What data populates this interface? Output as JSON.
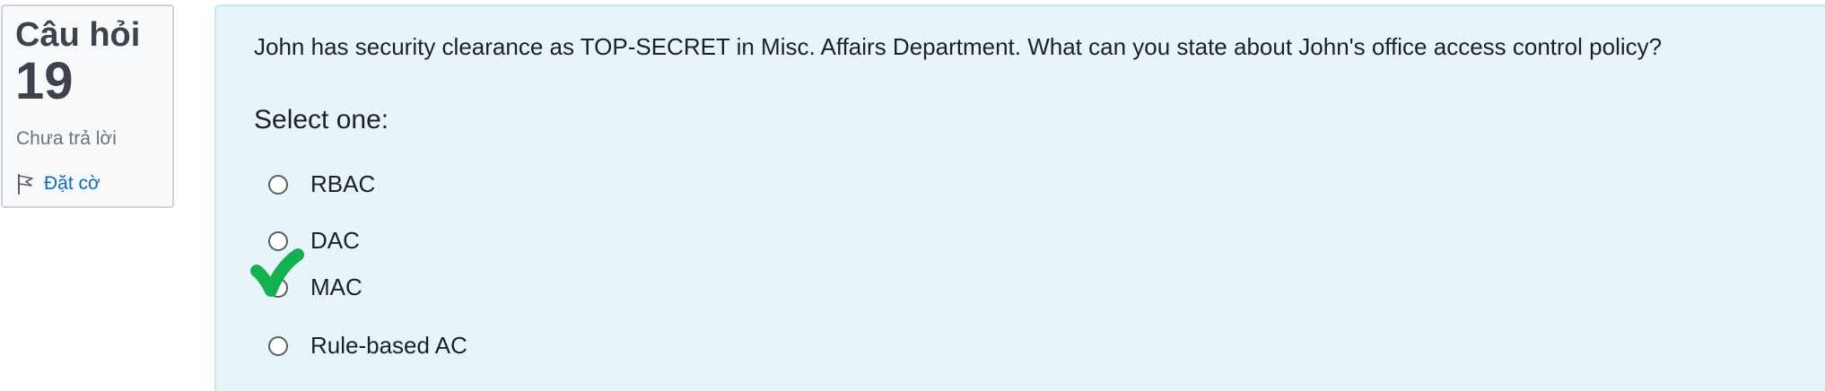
{
  "info": {
    "question_label": "Câu hỏi",
    "question_number": "19",
    "state": "Chưa trả lời",
    "flag_label": "Đặt cờ"
  },
  "question": {
    "text": "John has security clearance as TOP-SECRET in Misc. Affairs Department. What can you state about John's office access control policy?",
    "prompt": "Select one:",
    "options": [
      {
        "label": "RBAC"
      },
      {
        "label": "DAC"
      },
      {
        "label": "MAC"
      },
      {
        "label": "Rule-based AC"
      }
    ],
    "annotation": {
      "marked_option": "MAC",
      "mark_color": "#13b04f"
    }
  },
  "icons": {
    "flag": "flag-icon",
    "mark": "green-check-mark-icon"
  }
}
